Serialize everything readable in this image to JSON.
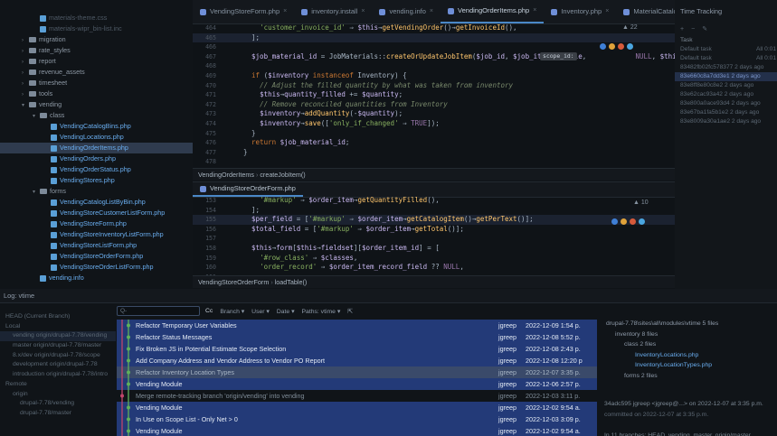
{
  "project_tree": {
    "items": [
      {
        "label": "materials-theme.css",
        "kind": "file",
        "indent": 3,
        "dim": true
      },
      {
        "label": "materials-wipr_bin-list.inc",
        "kind": "file",
        "indent": 3,
        "dim": true
      },
      {
        "label": "migration",
        "kind": "folder",
        "indent": 2
      },
      {
        "label": "rate_styles",
        "kind": "folder",
        "indent": 2
      },
      {
        "label": "report",
        "kind": "folder",
        "indent": 2
      },
      {
        "label": "revenue_assets",
        "kind": "folder",
        "indent": 2
      },
      {
        "label": "timesheet",
        "kind": "folder",
        "indent": 2
      },
      {
        "label": "tools",
        "kind": "folder",
        "indent": 2
      },
      {
        "label": "vending",
        "kind": "folder",
        "indent": 2,
        "open": true
      },
      {
        "label": "class",
        "kind": "folder",
        "indent": 3,
        "open": true
      },
      {
        "label": "VendingCatalogBins.php",
        "kind": "php",
        "indent": 4
      },
      {
        "label": "VendingLocations.php",
        "kind": "php",
        "indent": 4
      },
      {
        "label": "VendingOrderItems.php",
        "kind": "php",
        "indent": 4,
        "selected": true
      },
      {
        "label": "VendingOrders.php",
        "kind": "php",
        "indent": 4
      },
      {
        "label": "VendingOrderStatus.php",
        "kind": "php",
        "indent": 4
      },
      {
        "label": "VendingStores.php",
        "kind": "php",
        "indent": 4
      },
      {
        "label": "forms",
        "kind": "folder",
        "indent": 3,
        "open": true
      },
      {
        "label": "VendingCatalogListByBin.php",
        "kind": "php",
        "indent": 4
      },
      {
        "label": "VendingStoreCustomerListForm.php",
        "kind": "php",
        "indent": 4
      },
      {
        "label": "VendingStoreForm.php",
        "kind": "php",
        "indent": 4
      },
      {
        "label": "VendingStoreInventoryListForm.php",
        "kind": "php",
        "indent": 4
      },
      {
        "label": "VendingStoreListForm.php",
        "kind": "php",
        "indent": 4
      },
      {
        "label": "VendingStoreOrderForm.php",
        "kind": "php",
        "indent": 4
      },
      {
        "label": "VendingStoreOrderListForm.php",
        "kind": "php",
        "indent": 4
      },
      {
        "label": "vending.info",
        "kind": "php",
        "indent": 3
      }
    ]
  },
  "editor": {
    "tabs": [
      {
        "label": "VendingStoreForm.php",
        "active": false
      },
      {
        "label": "inventory.install",
        "active": false
      },
      {
        "label": "vending.info",
        "active": false
      },
      {
        "label": "VendingOrderItems.php",
        "active": true
      },
      {
        "label": "Inventory.php",
        "active": false
      },
      {
        "label": "MaterialCatalog.php",
        "active": false
      }
    ],
    "top_pane": {
      "warnings": "▲ 22",
      "breadcrumb": [
        "VendingOrderItems",
        "createJobItem()"
      ],
      "param_hint": "scope_id:",
      "lines": [
        {
          "n": "464",
          "html": "    <span class=\"str\">'customer_invoice_id'</span> ⇒ <span class=\"var\">$this</span>→<span class=\"fn\">getVendingOrder</span>()→<span class=\"fn\">getInvoiceId</span>(),"
        },
        {
          "n": "465",
          "html": "  ];",
          "hl": true
        },
        {
          "n": "466",
          "html": ""
        },
        {
          "n": "467",
          "html": "  <span class=\"var\">$job_material_id</span> = JobMaterials::<span class=\"fn\">createOrUpdateJobItem</span>(<span class=\"var\">$job_id</span>, <span class=\"var\">$job_item</span>, <span class=\"var\">$style</span>,            <span class=\"cn\">NULL</span>, <span class=\"var\">$this</span>→<span class=\"fn\">getVendingOrder</span>"
        },
        {
          "n": "468",
          "html": ""
        },
        {
          "n": "469",
          "html": "  <span class=\"kw\">if</span> (<span class=\"var\">$inventory</span> <span class=\"kw\">instanceof</span> Inventory) {"
        },
        {
          "n": "470",
          "html": "    <span class=\"cm\">// Adjust the filled quantity by what was taken from inventory</span>"
        },
        {
          "n": "471",
          "html": "    <span class=\"var\">$this</span>→<span class=\"var\">quantity_filled</span> += <span class=\"var\">$quantity</span>;"
        },
        {
          "n": "472",
          "html": "    <span class=\"cm\">// Remove reconciled quantities from Inventory</span>"
        },
        {
          "n": "473",
          "html": "    <span class=\"var\">$inventory</span>→<span class=\"fn\">addQuantity</span>(-<span class=\"var\">$quantity</span>);"
        },
        {
          "n": "474",
          "html": "    <span class=\"var\">$inventory</span>→<span class=\"fn\">save</span>([<span class=\"str\">'only_if_changed'</span> ⇒ <span class=\"cn\">TRUE</span>]);"
        },
        {
          "n": "475",
          "html": "  }"
        },
        {
          "n": "476",
          "html": "  <span class=\"kw\">return</span> <span class=\"var\">$job_material_id</span>;"
        },
        {
          "n": "477",
          "html": "}"
        },
        {
          "n": "478",
          "html": ""
        }
      ]
    },
    "bottom_pane": {
      "tab": "VendingStoreOrderForm.php",
      "warnings": "▲ 10",
      "breadcrumb": [
        "VendingStoreOrderForm",
        "loadTable()"
      ],
      "lines": [
        {
          "n": "153",
          "html": "    <span class=\"str\">'#markup'</span> ⇒ <span class=\"var\">$order_item</span>→<span class=\"fn\">getQuantityFilled</span>(),"
        },
        {
          "n": "154",
          "html": "  ];"
        },
        {
          "n": "155",
          "html": "  <span class=\"var\">$per_field</span> = [<span class=\"str\">'#markup'</span> ⇒ <span class=\"var\">$order_item</span>→<span class=\"fn\">getCatalogItem</span>()→<span class=\"fn\">getPerText</span>()];",
          "hl": true
        },
        {
          "n": "156",
          "html": "  <span class=\"var\">$total_field</span> = [<span class=\"str\">'#markup'</span> ⇒ <span class=\"var\">$order_item</span>→<span class=\"fn\">getTotal</span>()];"
        },
        {
          "n": "157",
          "html": ""
        },
        {
          "n": "158",
          "html": "  <span class=\"var\">$this</span>→<span class=\"var\">form</span>[<span class=\"var\">$this</span>→<span class=\"var\">fieldset</span>][<span class=\"var\">$order_item_id</span>] = ["
        },
        {
          "n": "159",
          "html": "    <span class=\"str\">'#row_class'</span> ⇒ <span class=\"var\">$classes</span>,"
        },
        {
          "n": "160",
          "html": "    <span class=\"str\">'order_record'</span> ⇒ <span class=\"var\">$order_item_record_field</span> ?? <span class=\"cn\">NULL</span>,"
        },
        {
          "n": "161",
          "html": ""
        }
      ]
    }
  },
  "time_tracking": {
    "title": "Time Tracking",
    "header_task": "Task",
    "rows": [
      {
        "label": "Default task",
        "value": "All 0:01",
        "selected": false
      },
      {
        "label": "Default task",
        "value": "All 0:01",
        "selected": false
      },
      {
        "label": "83482fb02fc578377 2 days ago",
        "value": "",
        "selected": false
      },
      {
        "label": "83e660c8a7dd3e1 2 days ago",
        "value": "",
        "selected": true
      },
      {
        "label": "83e8ff8e80c8e2 2 days ago",
        "value": "",
        "selected": false
      },
      {
        "label": "83e62cac93a42 2 days ago",
        "value": "",
        "selected": false
      },
      {
        "label": "83e800a0ace93d4 2 days ago",
        "value": "",
        "selected": false
      },
      {
        "label": "83e67ba1fa5b1e2 2 days ago",
        "value": "",
        "selected": false
      },
      {
        "label": "83e8009a30a1ae2 2 days ago",
        "value": "",
        "selected": false
      }
    ]
  },
  "git_log": {
    "title": "Log: vtime",
    "branches": [
      {
        "label": "HEAD (Current Branch)",
        "selected": false
      },
      {
        "label": "Local",
        "selected": false
      },
      {
        "label": "vending  origin/drupal-7.78/vending",
        "selected": true
      },
      {
        "label": "master  origin/drupal-7.78/master",
        "selected": false
      },
      {
        "label": "8.x/dev  origin/drupal-7.78/scope",
        "selected": false
      },
      {
        "label": "development  origin/drupal-7.78",
        "selected": false
      },
      {
        "label": "introduction  origin/drupal-7.78/intro",
        "selected": false
      },
      {
        "label": "Remote",
        "selected": false
      },
      {
        "label": "origin",
        "selected": false
      },
      {
        "label": "drupal-7.78/vending",
        "selected": false
      },
      {
        "label": "drupal-7.78/master",
        "selected": false
      }
    ],
    "filter": {
      "search_placeholder": "Q-",
      "cc": "Cc",
      "branch": "Branch",
      "user": "User",
      "date": "Date",
      "paths": "Paths: vtime"
    },
    "commits": [
      {
        "msg": "Refactor Temporary User Variables",
        "author": "jgreep",
        "date": "2022-12-09 1:54 p.",
        "style": "blue"
      },
      {
        "msg": "Refactor Status Messages",
        "author": "jgreep",
        "date": "2022-12-08 5:52 p.",
        "style": "blue"
      },
      {
        "msg": "Fix Broken JS in Potential Estimate Scope Selection",
        "author": "jgreep",
        "date": "2022-12-08 2:43 p.",
        "style": "blue"
      },
      {
        "msg": "Add Company Address and Vendor Address to Vendor PO Report",
        "author": "jgreep",
        "date": "2022-12-08 12:20 p",
        "style": "blue"
      },
      {
        "msg": "Refactor Inventory Location Types",
        "author": "jgreep",
        "date": "2022-12-07 3:35 p.",
        "style": "sel"
      },
      {
        "msg": "Vending Module",
        "author": "jgreep",
        "date": "2022-12-06 2:57 p.",
        "style": "blue"
      },
      {
        "msg": "Merge remote-tracking branch 'origin/vending' into vending",
        "author": "jgreep",
        "date": "2022-12-03 3:11 p.",
        "style": "dim"
      },
      {
        "msg": "Vending Module",
        "author": "jgreep",
        "date": "2022-12-02 9:54 a.",
        "style": "blue"
      },
      {
        "msg": "In Use on Scope List - Only Net > 0",
        "author": "jgreep",
        "date": "2022-12-03 3:09 p.",
        "style": "blue"
      },
      {
        "msg": "Vending Module",
        "author": "jgreep",
        "date": "2022-12-02 9:54 a.",
        "style": "blue"
      }
    ],
    "details": {
      "root": "drupal-7.78\\sites\\all\\modules\\vtime  5 files",
      "inventory": "inventory  8 files",
      "class": "class  2 files",
      "files": [
        "InventoryLocations.php",
        "InventoryLocationTypes.php"
      ],
      "forms": "forms  2 files",
      "commit_hash": "34adc595 jgreep <jgreep@...> on 2022-12-07 at 3:35 p.m.",
      "committed": "committed on 2022-12-07 at 3:35 p.m.",
      "branches_line": "In 11 branches: HEAD, vending, master, origin/master ..."
    }
  }
}
